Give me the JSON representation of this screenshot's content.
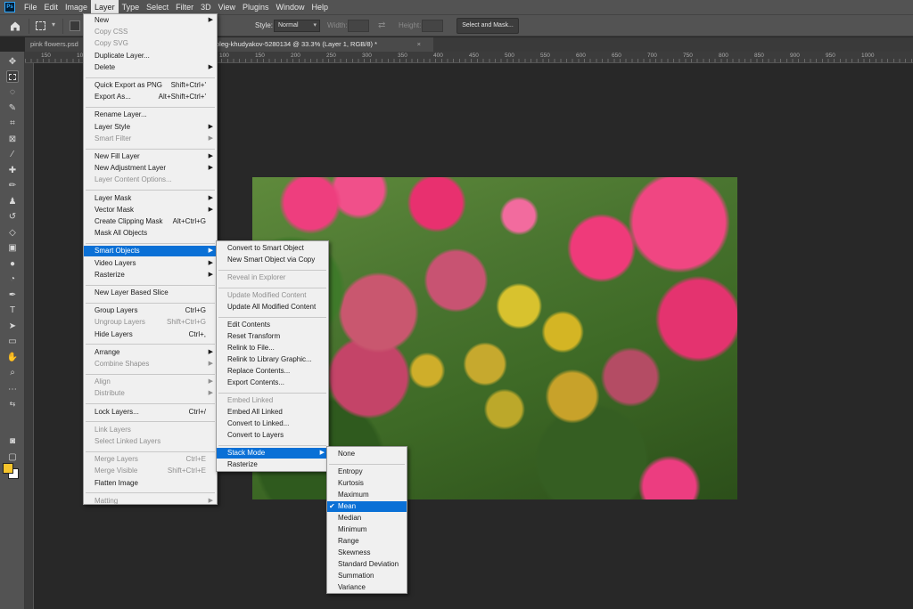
{
  "menubar": {
    "logo": "Ps",
    "items": [
      "File",
      "Edit",
      "Image",
      "Layer",
      "Type",
      "Select",
      "Filter",
      "3D",
      "View",
      "Plugins",
      "Window",
      "Help"
    ],
    "active": "Layer"
  },
  "options": {
    "style_label": "Style:",
    "style_value": "Normal",
    "width_label": "Width:",
    "height_label": "Height:",
    "select_mask_label": "Select and Mask..."
  },
  "tabs": [
    {
      "label": "pink flowers.psd"
    },
    {
      "label": "oleg-khudyakov-5280134 @ 33.3% (Layer 1, RGB/8) *",
      "close": "×"
    }
  ],
  "ruler": {
    "numbers": [
      "150",
      "100",
      "50",
      "0",
      "50",
      "100",
      "150",
      "200",
      "250",
      "300",
      "350",
      "400",
      "450",
      "500",
      "550",
      "600",
      "650",
      "700",
      "750",
      "800",
      "850",
      "900",
      "950",
      "1000"
    ]
  },
  "colors": {
    "foreground": "#f7c52c",
    "background": "#ffffff",
    "highlight": "#0a70d6"
  },
  "layer_menu": [
    {
      "label": "New",
      "arrow": true
    },
    {
      "label": "Copy CSS",
      "disabled": true
    },
    {
      "label": "Copy SVG",
      "disabled": true
    },
    {
      "label": "Duplicate Layer..."
    },
    {
      "label": "Delete",
      "arrow": true
    },
    {
      "sep": true
    },
    {
      "label": "Quick Export as PNG",
      "shortcut": "Shift+Ctrl+'"
    },
    {
      "label": "Export As...",
      "shortcut": "Alt+Shift+Ctrl+'"
    },
    {
      "sep": true
    },
    {
      "label": "Rename Layer..."
    },
    {
      "label": "Layer Style",
      "arrow": true
    },
    {
      "label": "Smart Filter",
      "disabled": true,
      "arrow": true
    },
    {
      "sep": true
    },
    {
      "label": "New Fill Layer",
      "arrow": true
    },
    {
      "label": "New Adjustment Layer",
      "arrow": true
    },
    {
      "label": "Layer Content Options...",
      "disabled": true
    },
    {
      "sep": true
    },
    {
      "label": "Layer Mask",
      "arrow": true
    },
    {
      "label": "Vector Mask",
      "arrow": true
    },
    {
      "label": "Create Clipping Mask",
      "shortcut": "Alt+Ctrl+G"
    },
    {
      "label": "Mask All Objects"
    },
    {
      "sep": true
    },
    {
      "label": "Smart Objects",
      "arrow": true,
      "highlight": true
    },
    {
      "label": "Video Layers",
      "arrow": true
    },
    {
      "label": "Rasterize",
      "arrow": true
    },
    {
      "sep": true
    },
    {
      "label": "New Layer Based Slice"
    },
    {
      "sep": true
    },
    {
      "label": "Group Layers",
      "shortcut": "Ctrl+G"
    },
    {
      "label": "Ungroup Layers",
      "shortcut": "Shift+Ctrl+G",
      "disabled": true
    },
    {
      "label": "Hide Layers",
      "shortcut": "Ctrl+,"
    },
    {
      "sep": true
    },
    {
      "label": "Arrange",
      "arrow": true
    },
    {
      "label": "Combine Shapes",
      "disabled": true,
      "arrow": true
    },
    {
      "sep": true
    },
    {
      "label": "Align",
      "disabled": true,
      "arrow": true
    },
    {
      "label": "Distribute",
      "disabled": true,
      "arrow": true
    },
    {
      "sep": true
    },
    {
      "label": "Lock Layers...",
      "shortcut": "Ctrl+/"
    },
    {
      "sep": true
    },
    {
      "label": "Link Layers",
      "disabled": true
    },
    {
      "label": "Select Linked Layers",
      "disabled": true
    },
    {
      "sep": true
    },
    {
      "label": "Merge Layers",
      "shortcut": "Ctrl+E",
      "disabled": true
    },
    {
      "label": "Merge Visible",
      "shortcut": "Shift+Ctrl+E",
      "disabled": true
    },
    {
      "label": "Flatten Image"
    },
    {
      "sep": true
    },
    {
      "label": "Matting",
      "disabled": true,
      "arrow": true
    }
  ],
  "smart_menu": [
    {
      "label": "Convert to Smart Object"
    },
    {
      "label": "New Smart Object via Copy"
    },
    {
      "sep": true
    },
    {
      "label": "Reveal in Explorer",
      "disabled": true
    },
    {
      "sep": true
    },
    {
      "label": "Update Modified Content",
      "disabled": true
    },
    {
      "label": "Update All Modified Content"
    },
    {
      "sep": true
    },
    {
      "label": "Edit Contents"
    },
    {
      "label": "Reset Transform"
    },
    {
      "label": "Relink to File..."
    },
    {
      "label": "Relink to Library Graphic..."
    },
    {
      "label": "Replace Contents..."
    },
    {
      "label": "Export Contents..."
    },
    {
      "sep": true
    },
    {
      "label": "Embed Linked",
      "disabled": true
    },
    {
      "label": "Embed All Linked"
    },
    {
      "label": "Convert to Linked..."
    },
    {
      "label": "Convert to Layers"
    },
    {
      "sep": true
    },
    {
      "label": "Stack Mode",
      "arrow": true,
      "highlight": true
    },
    {
      "label": "Rasterize"
    }
  ],
  "stack_menu": [
    {
      "label": "None"
    },
    {
      "sep": true
    },
    {
      "label": "Entropy"
    },
    {
      "label": "Kurtosis"
    },
    {
      "label": "Maximum"
    },
    {
      "label": "Mean",
      "highlight": true,
      "checked": true
    },
    {
      "label": "Median"
    },
    {
      "label": "Minimum"
    },
    {
      "label": "Range"
    },
    {
      "label": "Skewness"
    },
    {
      "label": "Standard Deviation"
    },
    {
      "label": "Summation"
    },
    {
      "label": "Variance"
    }
  ]
}
